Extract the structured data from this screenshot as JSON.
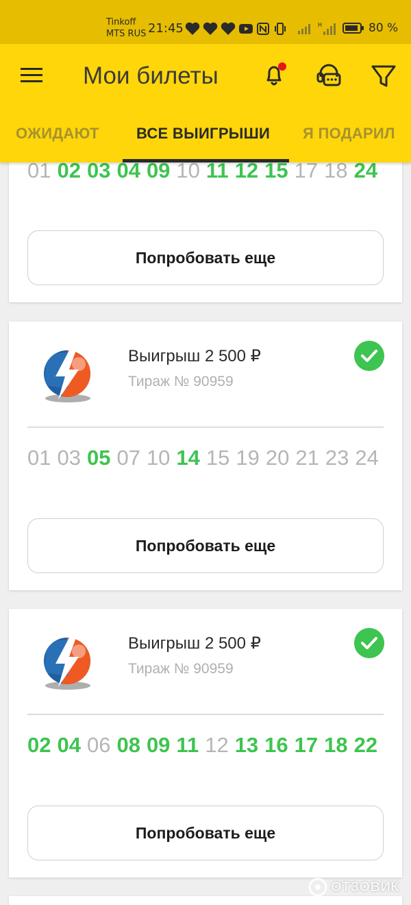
{
  "status_bar": {
    "carrier_line1": "Tinkoff",
    "carrier_line2": "MTS RUS",
    "time": "21:45",
    "battery": "80 %"
  },
  "header": {
    "title": "Мои билеты",
    "menu_icon": "hamburger-menu-icon",
    "notification_icon": "bell-icon",
    "support_icon": "support-chat-icon",
    "filter_icon": "filter-icon",
    "notification_dot_color": "#e8141b"
  },
  "tabs": [
    {
      "label": "ОЖИДАЮТ",
      "active": false
    },
    {
      "label": "ВСЕ ВЫИГРЫШИ",
      "active": true
    },
    {
      "label": "Я ПОДАРИЛ",
      "active": false
    }
  ],
  "colors": {
    "header_bg": "#ffd60a",
    "status_bg": "#e6bd00",
    "hit_number": "#3ec450",
    "miss_number": "#b5b5b5"
  },
  "tickets": [
    {
      "numbers": [
        {
          "n": "01",
          "hit": false
        },
        {
          "n": "02",
          "hit": true
        },
        {
          "n": "03",
          "hit": true
        },
        {
          "n": "04",
          "hit": true
        },
        {
          "n": "09",
          "hit": true
        },
        {
          "n": "10",
          "hit": false
        },
        {
          "n": "11",
          "hit": true
        },
        {
          "n": "12",
          "hit": true
        },
        {
          "n": "15",
          "hit": true
        },
        {
          "n": "17",
          "hit": false
        },
        {
          "n": "18",
          "hit": false
        },
        {
          "n": "24",
          "hit": true
        }
      ],
      "button": "Попробовать еще"
    },
    {
      "win": "Выигрыш 2 500 ₽",
      "draw": "Тираж № 90959",
      "numbers": [
        {
          "n": "01",
          "hit": false
        },
        {
          "n": "03",
          "hit": false
        },
        {
          "n": "05",
          "hit": true
        },
        {
          "n": "07",
          "hit": false
        },
        {
          "n": "10",
          "hit": false
        },
        {
          "n": "14",
          "hit": true
        },
        {
          "n": "15",
          "hit": false
        },
        {
          "n": "19",
          "hit": false
        },
        {
          "n": "20",
          "hit": false
        },
        {
          "n": "21",
          "hit": false
        },
        {
          "n": "23",
          "hit": false
        },
        {
          "n": "24",
          "hit": false
        }
      ],
      "button": "Попробовать еще"
    },
    {
      "win": "Выигрыш 2 500 ₽",
      "draw": "Тираж № 90959",
      "numbers": [
        {
          "n": "02",
          "hit": true
        },
        {
          "n": "04",
          "hit": true
        },
        {
          "n": "06",
          "hit": false
        },
        {
          "n": "08",
          "hit": true
        },
        {
          "n": "09",
          "hit": true
        },
        {
          "n": "11",
          "hit": true
        },
        {
          "n": "12",
          "hit": false
        },
        {
          "n": "13",
          "hit": true
        },
        {
          "n": "16",
          "hit": true
        },
        {
          "n": "17",
          "hit": true
        },
        {
          "n": "18",
          "hit": true
        },
        {
          "n": "22",
          "hit": true
        }
      ],
      "button": "Попробовать еще"
    }
  ],
  "watermark": "ОТЗОВИК"
}
